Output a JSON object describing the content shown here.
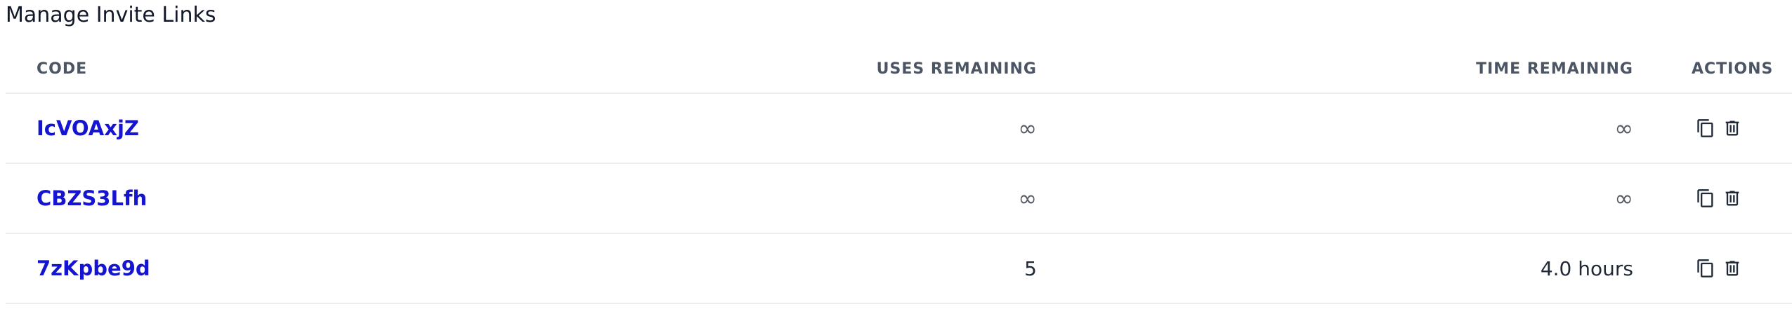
{
  "page": {
    "title": "Manage Invite Links"
  },
  "table": {
    "headers": {
      "code": "CODE",
      "uses_remaining": "USES REMAINING",
      "time_remaining": "TIME REMAINING",
      "actions": "ACTIONS"
    },
    "rows": [
      {
        "code": "IcVOAxjZ",
        "uses_remaining": "∞",
        "time_remaining": "∞"
      },
      {
        "code": "CBZS3Lfh",
        "uses_remaining": "∞",
        "time_remaining": "∞"
      },
      {
        "code": "7zKpbe9d",
        "uses_remaining": "5",
        "time_remaining": "4.0 hours"
      }
    ]
  },
  "icons": {
    "copy": "copy-icon",
    "delete": "trash-icon"
  },
  "colors": {
    "link": "#1414d1",
    "header_text": "#4b5563",
    "divider": "#eceef1"
  }
}
